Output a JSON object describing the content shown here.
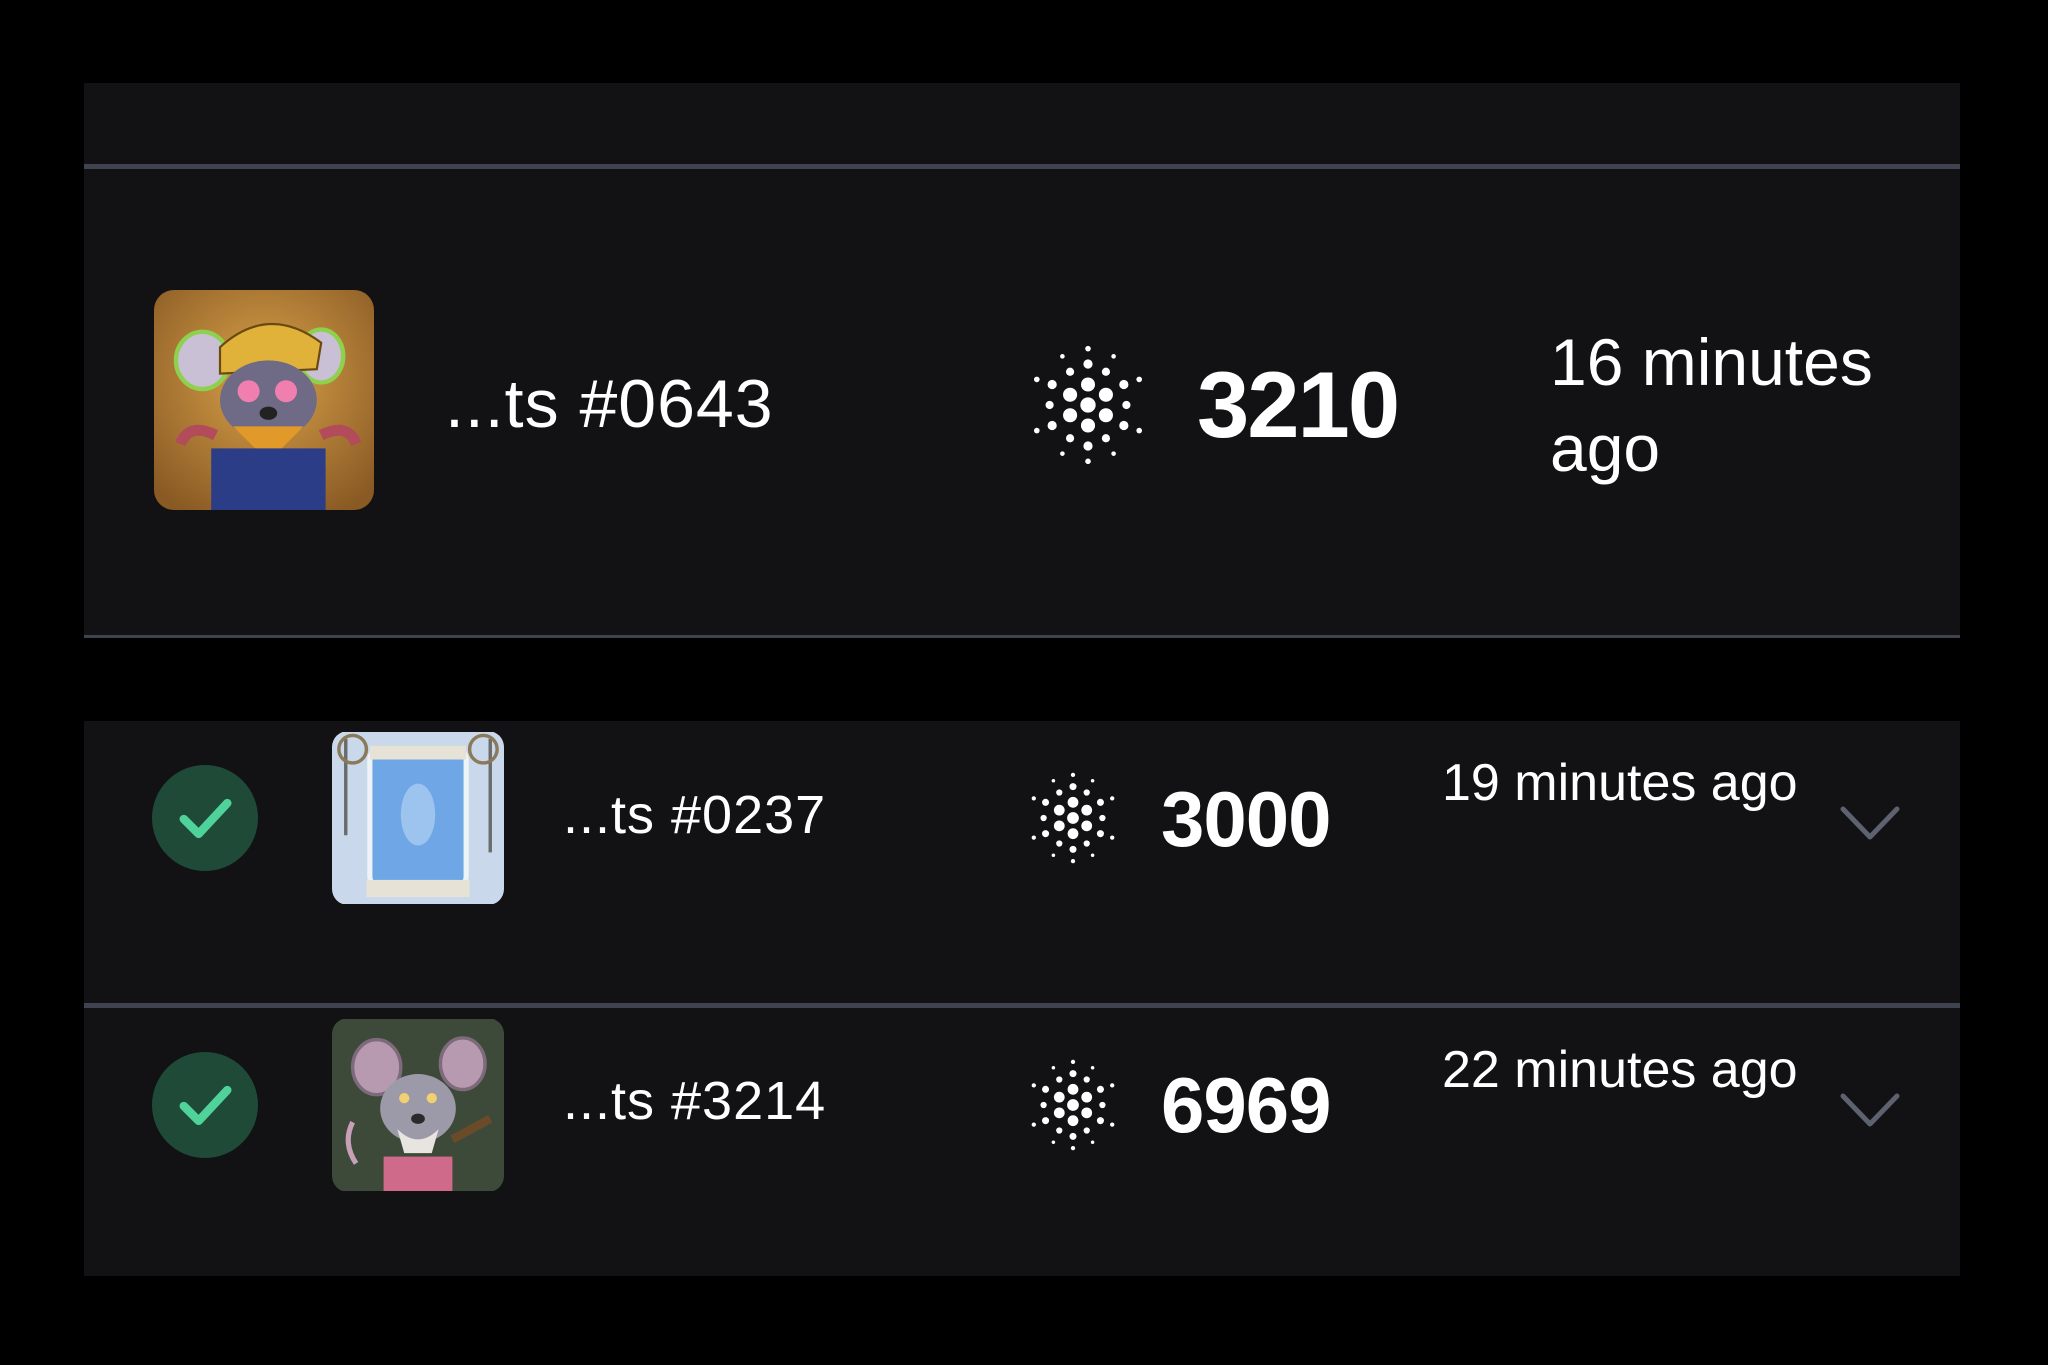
{
  "colors": {
    "background": "#000000",
    "panel": "#121214",
    "divider": "#3f4350",
    "check_bg": "#1f4a38",
    "check_mark": "#4fd39a",
    "chevron": "#5e6270",
    "text": "#ffffff"
  },
  "featured": {
    "name": "...ts #0643",
    "price": "3210",
    "time": "16 minutes ago",
    "currency_icon": "cardano-icon",
    "thumbnail": "rat-with-hat-avatar"
  },
  "rows": [
    {
      "name": "...ts #0237",
      "price": "3000",
      "time": "19 minutes ago",
      "status_icon": "checkmark-icon",
      "currency_icon": "cardano-icon",
      "thumbnail": "rat-in-tank-avatar",
      "expand_icon": "chevron-down-icon"
    },
    {
      "name": "...ts #3214",
      "price": "6969",
      "time": "22 minutes ago",
      "status_icon": "checkmark-icon",
      "currency_icon": "cardano-icon",
      "thumbnail": "rat-with-pipe-avatar",
      "expand_icon": "chevron-down-icon"
    }
  ]
}
